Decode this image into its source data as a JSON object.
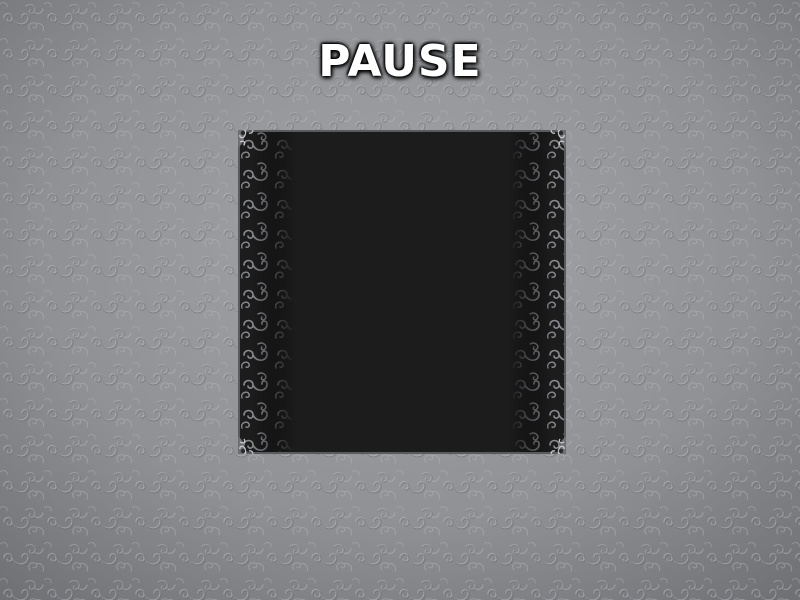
{
  "screen": {
    "title": "PAUSE",
    "background_color": "#8e9094",
    "panel_color": "#1c1c1d",
    "frame_color": "#5a5b5e",
    "ornament_color": "#8a8b8f"
  }
}
